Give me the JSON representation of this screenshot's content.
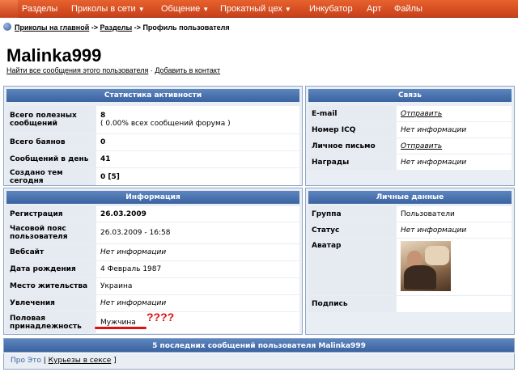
{
  "nav": {
    "items": [
      {
        "label": "Разделы",
        "caret": false
      },
      {
        "label": "Приколы в сети",
        "caret": true
      },
      {
        "label": "Общение",
        "caret": true
      },
      {
        "label": "Прокатный цех",
        "caret": true
      },
      {
        "label": "Инкубатор",
        "caret": false
      },
      {
        "label": "Арт",
        "caret": false
      },
      {
        "label": "Файлы",
        "caret": false
      }
    ]
  },
  "breadcrumb": {
    "home": "Приколы на главной",
    "sep1": "->",
    "section": "Разделы",
    "sep2": "->",
    "current": "Профиль пользователя"
  },
  "profile": {
    "username": "Malinka999",
    "find_posts": "Найти все сообщения этого пользователя",
    "dot": " · ",
    "add_contact": "Добавить в контакт"
  },
  "stats": {
    "title": "Статистика активности",
    "rows": [
      {
        "label": "Всего полезных сообщений",
        "value": "8",
        "sub": "( 0.00% всех сообщений форума )"
      },
      {
        "label": "Всего баянов",
        "value": "0"
      },
      {
        "label": "Сообщений в день",
        "value": "41"
      },
      {
        "label": "Создано тем сегодня",
        "value": "0 [5]"
      }
    ]
  },
  "contact": {
    "title": "Связь",
    "rows": [
      {
        "label": "E-mail",
        "value": "Отправить"
      },
      {
        "label": "Номер ICQ",
        "value": "Нет информации"
      },
      {
        "label": "Личное письмо",
        "value": "Отправить"
      },
      {
        "label": "Награды",
        "value": "Нет информации"
      }
    ]
  },
  "info": {
    "title": "Информация",
    "rows": [
      {
        "label": "Регистрация",
        "value": "26.03.2009"
      },
      {
        "label": "Часовой пояс пользователя",
        "value": "26.03.2009 - 16:58"
      },
      {
        "label": "Вебсайт",
        "value": "Нет информации"
      },
      {
        "label": "Дата рождения",
        "value": "4 Февраль 1987"
      },
      {
        "label": "Место жительства",
        "value": "Украина"
      },
      {
        "label": "Увлечения",
        "value": "Нет информации"
      },
      {
        "label": "Половая принадлежность",
        "value": "Мужчина"
      }
    ]
  },
  "personal": {
    "title": "Личные данные",
    "rows": [
      {
        "label": "Группа",
        "value": "Пользователи"
      },
      {
        "label": "Статус",
        "value": "Нет информации"
      },
      {
        "label": "Аватар",
        "value": ""
      },
      {
        "label": "Подпись",
        "value": ""
      }
    ]
  },
  "annotation": {
    "text": "????",
    "color": "#e01010"
  },
  "last_posts": {
    "title": "5 последних сообщений пользователя Malinka999",
    "item_prefix": "Про Это",
    "item_sep": " | ",
    "item_link": "Курьезы в сексе",
    "item_suffix": " ]"
  },
  "colors": {
    "nav": "#d9501f",
    "panel_header": "#4a72ae",
    "accent_red": "#e01010"
  }
}
